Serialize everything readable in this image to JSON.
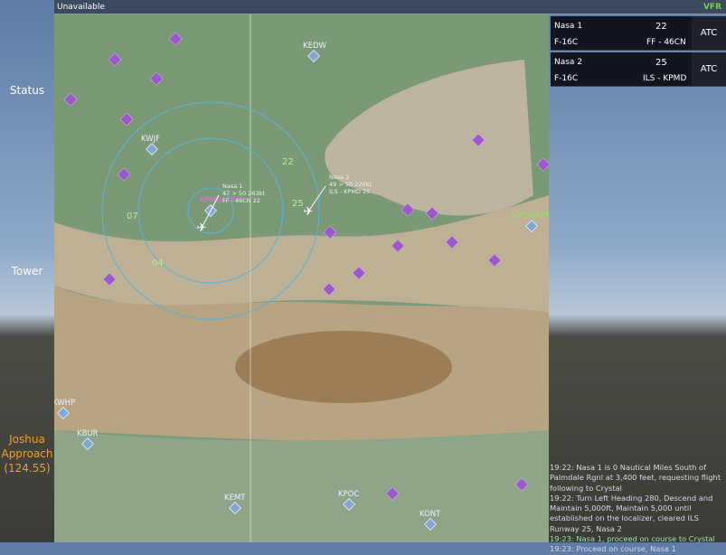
{
  "topbar": {
    "status": "Unavailable",
    "mode": "VFR"
  },
  "left": {
    "status": "Status",
    "tower": "Tower",
    "approach": "Joshua Approach",
    "frequency": "(124.55)"
  },
  "strips": [
    {
      "callsign": "Nasa 1",
      "type": "F-16C",
      "value": "22",
      "route": "FF - 46CN",
      "button": "ATC"
    },
    {
      "callsign": "Nasa 2",
      "type": "F-16C",
      "value": "25",
      "route": "ILS - KPMD",
      "button": "ATC"
    }
  ],
  "log": [
    {
      "text": "19:22: Nasa 1 is 0 Nautical Miles South of Palmdale Rgnl at 3,400 feet, requesting flight following to Crystal",
      "color": "w"
    },
    {
      "text": "19:22: Turn Left Heading 280, Descend and Maintain 5,000ft, Maintain 5,000 until established on the localizer, cleared ILS Runway 25, Nasa 2",
      "color": "w"
    },
    {
      "text": "19:23: Nasa 1, proceed on course to Crystal",
      "color": "g"
    },
    {
      "text": "19:23: Proceed on course, Nasa 1",
      "color": "w"
    }
  ],
  "map": {
    "airports": [
      "KEDW",
      "KWJF",
      "KPMD(APP)",
      "KVCV(APP)",
      "KWHP",
      "KBUR",
      "KEMT",
      "KPOC",
      "KONT"
    ],
    "runways": [
      "22",
      "25",
      "07",
      "04"
    ],
    "aircraft": [
      {
        "name": "Nasa 1",
        "alt": "47 > 50 263kt",
        "route": "FF - 46CN 22"
      },
      {
        "name": "Nasa 2",
        "alt": "49 > 50 220kt",
        "route": "ILS - KPMD 25"
      }
    ],
    "colors": {
      "waypoint": "#9b59c9",
      "airport": "#7fa9d0",
      "ring": "#5ab4d8"
    }
  }
}
